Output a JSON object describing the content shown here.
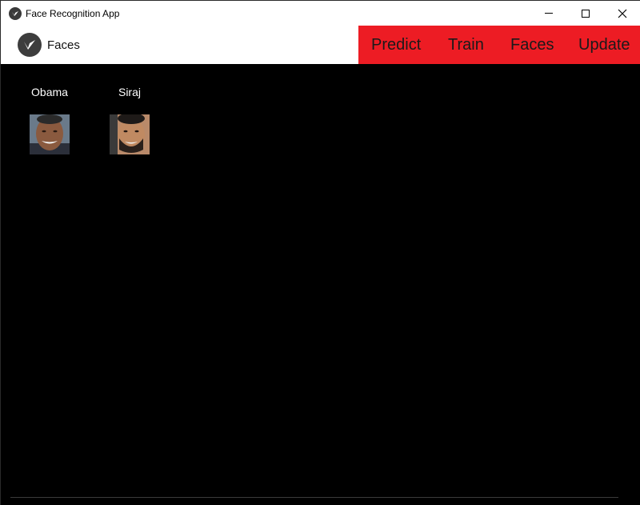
{
  "window": {
    "title": "Face Recognition App",
    "controls": [
      "minimize-icon",
      "maximize-icon",
      "close-icon"
    ]
  },
  "actionbar": {
    "brand_label": "Faces",
    "nav": [
      "Predict",
      "Train",
      "Faces",
      "Update"
    ],
    "accent_color": "#ed1c24"
  },
  "faces": [
    {
      "name": "Obama"
    },
    {
      "name": "Siraj"
    }
  ]
}
